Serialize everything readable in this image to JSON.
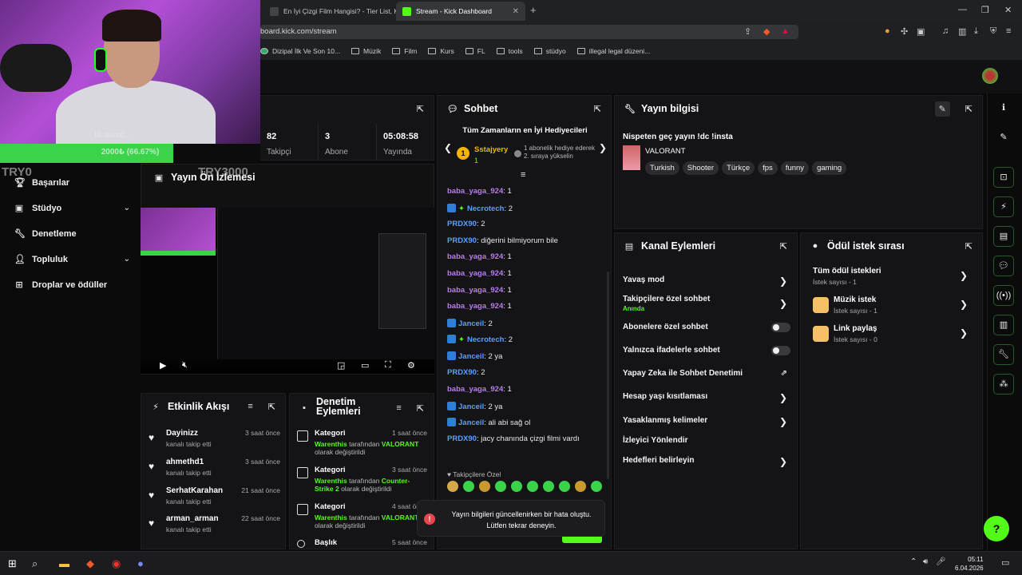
{
  "browser": {
    "tabs": [
      {
        "title": "En İyi Çizgi Film Hangisi? - Tier List, K"
      },
      {
        "title": "Stream - Kick Dashboard"
      }
    ],
    "url": "board.kick.com/stream",
    "bookmarks": [
      "Dizipal İlk Ve Son 10...",
      "Müzik",
      "Film",
      "Kurs",
      "FL",
      "tools",
      "stüdyo",
      "illegal legal düzeni..."
    ]
  },
  "webcam": {
    "donate_text": "2000₺ (66.67%)",
    "donate_progress": 0.6667,
    "overlay_left": "TRY0",
    "overlay_right": "TRY3000",
    "overlay_faint": "İlk donat..."
  },
  "sidebar": {
    "items": [
      {
        "label": "Başarılar"
      },
      {
        "label": "Stüdyo"
      },
      {
        "label": "Denetleme"
      },
      {
        "label": "Topluluk"
      },
      {
        "label": "Droplar ve ödüller"
      }
    ]
  },
  "stats": [
    {
      "value": "82",
      "label": "Takipçi"
    },
    {
      "value": "3",
      "label": "Abone"
    },
    {
      "value": "05:08:58",
      "label": "Yayında"
    }
  ],
  "preview": {
    "title": "Yayın Ön İzlemesi"
  },
  "activity": {
    "title": "Etkinlik Akışı",
    "items": [
      {
        "name": "Dayinizz",
        "desc": "kanalı takip etti",
        "time": "3 saat önce"
      },
      {
        "name": "ahmethd1",
        "desc": "kanalı takip etti",
        "time": "3 saat önce"
      },
      {
        "name": "SerhatKarahan",
        "desc": "kanalı takip etti",
        "time": "21 saat önce"
      },
      {
        "name": "arman_arman",
        "desc": "kanalı takip etti",
        "time": "22 saat önce"
      }
    ]
  },
  "moderation": {
    "title_line1": "Denetim",
    "title_line2": "Eylemleri",
    "items": [
      {
        "name": "Kategori",
        "time": "1 saat önce",
        "who": "Warenthis",
        "mid": " tarafından ",
        "what": "VALORANT",
        "end": "olarak değiştirildi"
      },
      {
        "name": "Kategori",
        "time": "3 saat önce",
        "who": "Warenthis",
        "mid": " tarafından ",
        "what": "Counter-Strike 2",
        "end": " olarak değiştirildi"
      },
      {
        "name": "Kategori",
        "time": "4 saat önce",
        "who": "Warenthis",
        "mid": " tarafından ",
        "what": "VALORANT",
        "end": "olarak değiştirildi"
      },
      {
        "name": "Başlık",
        "time": "5 saat önce"
      }
    ]
  },
  "chat": {
    "title": "Sohbet",
    "gifters_title": "Tüm Zamanların en İyi Hediyecileri",
    "top_gifter": "Sstajyery",
    "top_gifter_count": "1",
    "gift_note": "1 abonelik hediye ederek 2. sıraya yükselin",
    "messages": [
      {
        "user": "baba_yaga_924",
        "color": "p",
        "text": ": 1"
      },
      {
        "user": "Necrotech",
        "color": "b",
        "text": ": 2",
        "badges": true
      },
      {
        "user": "PRDX90",
        "color": "b",
        "text": ": 2"
      },
      {
        "user": "PRDX90",
        "color": "b",
        "text": ": diğerini bilmiyorum bile"
      },
      {
        "user": "baba_yaga_924",
        "color": "p",
        "text": ": 1"
      },
      {
        "user": "baba_yaga_924",
        "color": "p",
        "text": ": 1"
      },
      {
        "user": "baba_yaga_924",
        "color": "p",
        "text": ": 1"
      },
      {
        "user": "baba_yaga_924",
        "color": "p",
        "text": ": 1"
      },
      {
        "user": "Janceil",
        "color": "b",
        "text": ": 2",
        "vbadge": true
      },
      {
        "user": "Necrotech",
        "color": "b",
        "text": ": 2",
        "badges": true
      },
      {
        "user": "Janceil",
        "color": "b",
        "text": ": 2 ya",
        "vbadge": true
      },
      {
        "user": "PRDX90",
        "color": "b",
        "text": ": 2"
      },
      {
        "user": "baba_yaga_924",
        "color": "p",
        "text": ": 1"
      },
      {
        "user": "Janceil",
        "color": "b",
        "text": ": 2 ya",
        "vbadge": true
      },
      {
        "user": "Janceil",
        "color": "b",
        "text": ": ali abi sağ ol",
        "vbadge": true
      },
      {
        "user": "PRDX90",
        "color": "b",
        "text": ": jacy chanında çizgi filmi vardı"
      }
    ],
    "followers_only": "Takipçilere Özel"
  },
  "toast": {
    "line1": "Yayın bilgileri güncellenirken bir hata oluştu.",
    "line2": "Lütfen tekrar deneyin."
  },
  "stream_info": {
    "title": "Yayın bilgisi",
    "stream_title": "Nispeten geç yayın !dc !insta",
    "category": "VALORANT",
    "tags": [
      "Turkish",
      "Shooter",
      "Türkçe",
      "fps",
      "funny",
      "gaming"
    ]
  },
  "channel_actions": {
    "title": "Kanal Eylemleri",
    "items": [
      {
        "label": "Yavaş mod"
      },
      {
        "label": "Takipçilere özel sohbet",
        "sub": "Anında"
      },
      {
        "label": "Abonelere özel sohbet"
      },
      {
        "label": "Yalnızca ifadelerle sohbet"
      },
      {
        "label": "Yapay Zeka ile Sohbet Denetimi"
      },
      {
        "label": "Hesap yaşı kısıtlaması"
      },
      {
        "label": "Yasaklanmış kelimeler"
      },
      {
        "label": "İzleyici Yönlendir"
      },
      {
        "label": "Hedefleri belirleyin"
      }
    ]
  },
  "rewards": {
    "title": "Ödül istek sırası",
    "items": [
      {
        "title": "Tüm ödül istekleri",
        "sub": "İstek sayısı - 1"
      },
      {
        "title": "Müzik istek",
        "sub": "İstek sayısı - 1"
      },
      {
        "title": "Link paylaş",
        "sub": "İstek sayısı - 0"
      }
    ]
  },
  "clock": {
    "time": "05:11",
    "date": "6.04.2026"
  }
}
